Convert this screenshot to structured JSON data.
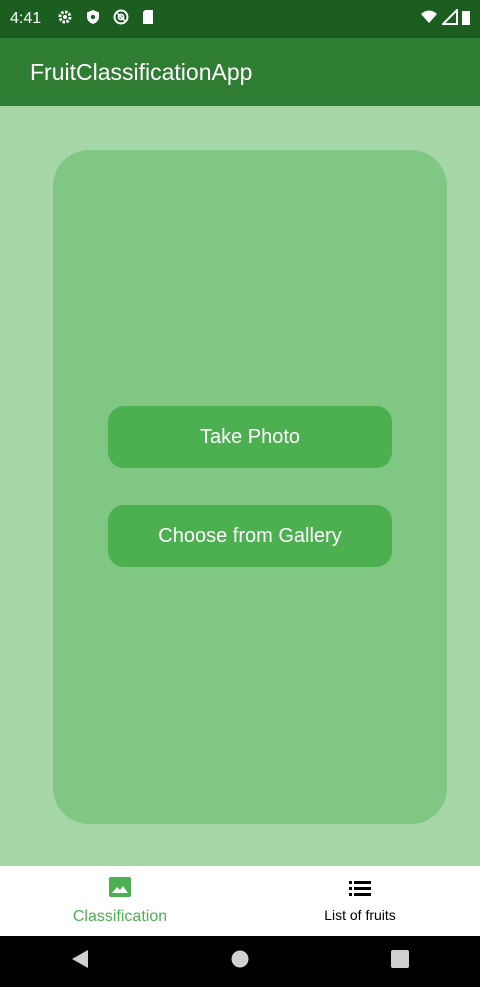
{
  "status_bar": {
    "time": "4:41",
    "icons": [
      "settings-icon",
      "shield-icon",
      "at-sign-icon",
      "sd-card-icon"
    ],
    "right_icons": [
      "wifi-icon",
      "signal-icon",
      "battery-icon"
    ]
  },
  "app_bar": {
    "title": "FruitClassificationApp"
  },
  "card": {
    "take_photo_label": "Take Photo",
    "choose_gallery_label": "Choose from Gallery"
  },
  "bottom_nav": {
    "items": [
      {
        "label": "Classification",
        "icon": "image-icon",
        "active": true
      },
      {
        "label": "List of fruits",
        "icon": "list-icon",
        "active": false
      }
    ]
  },
  "colors": {
    "status_bar": "#1b5e20",
    "app_bar": "#2e7d32",
    "background": "#a5d6a7",
    "card": "#81c784",
    "button": "#4caf50",
    "active_nav": "#4caf50"
  }
}
